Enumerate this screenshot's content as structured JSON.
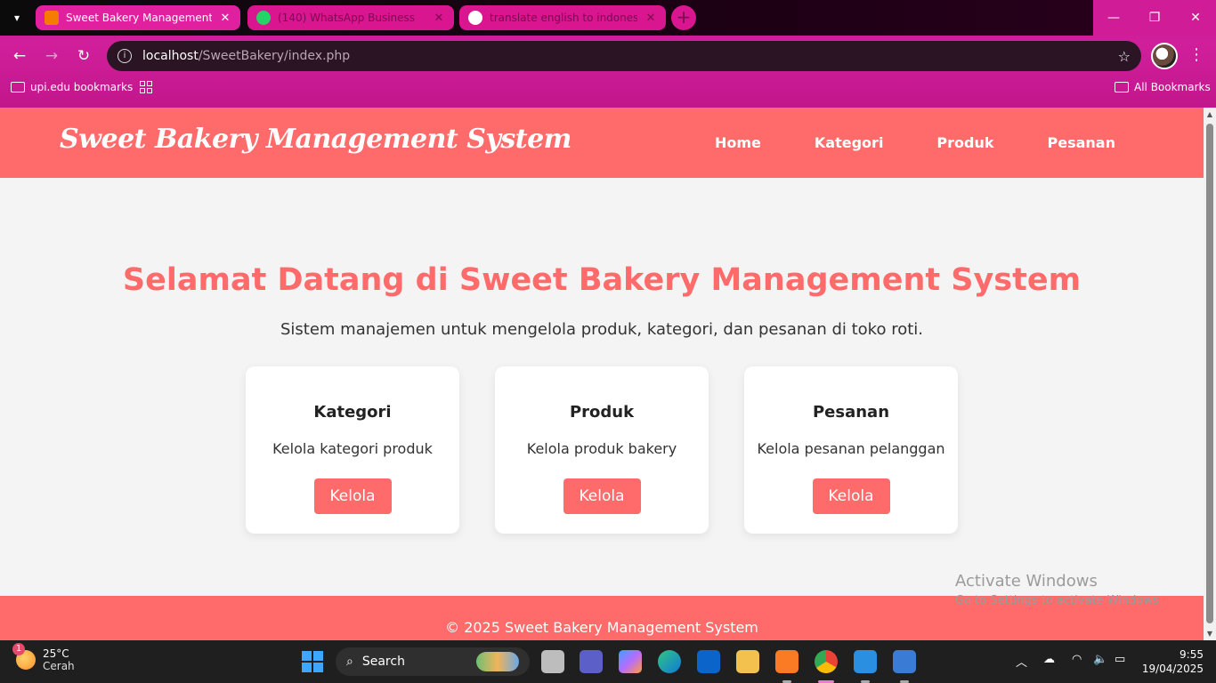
{
  "browser": {
    "tabs": [
      {
        "title": "Sweet Bakery Management Sys",
        "active": true
      },
      {
        "title": "(140) WhatsApp Business",
        "active": false
      },
      {
        "title": "translate english to indonesia",
        "active": false
      }
    ],
    "url_host": "localhost",
    "url_path": "/SweetBakery/index.php",
    "bookmarks": {
      "left": "upi.edu bookmarks",
      "right": "All Bookmarks"
    }
  },
  "site": {
    "brand": "Sweet Bakery Management System",
    "nav": [
      "Home",
      "Kategori",
      "Produk",
      "Pesanan"
    ]
  },
  "hero": {
    "title": "Selamat Datang di Sweet Bakery Management System",
    "subtitle": "Sistem manajemen untuk mengelola produk, kategori, dan pesanan di toko roti."
  },
  "cards": [
    {
      "title": "Kategori",
      "desc": "Kelola kategori produk",
      "button": "Kelola"
    },
    {
      "title": "Produk",
      "desc": "Kelola produk bakery",
      "button": "Kelola"
    },
    {
      "title": "Pesanan",
      "desc": "Kelola pesanan pelanggan",
      "button": "Kelola"
    }
  ],
  "watermark": {
    "line1": "Activate Windows",
    "line2": "Go to Settings to activate Windows."
  },
  "footer": {
    "copyright": "© 2025 Sweet Bakery Management System"
  },
  "taskbar": {
    "weather_temp": "25°C",
    "weather_desc": "Cerah",
    "weather_badge": "1",
    "search_label": "Search",
    "time": "9:55",
    "date": "19/04/2025"
  },
  "colors": {
    "accent": "#ff6b6b",
    "chrome": "#d11f9b"
  }
}
